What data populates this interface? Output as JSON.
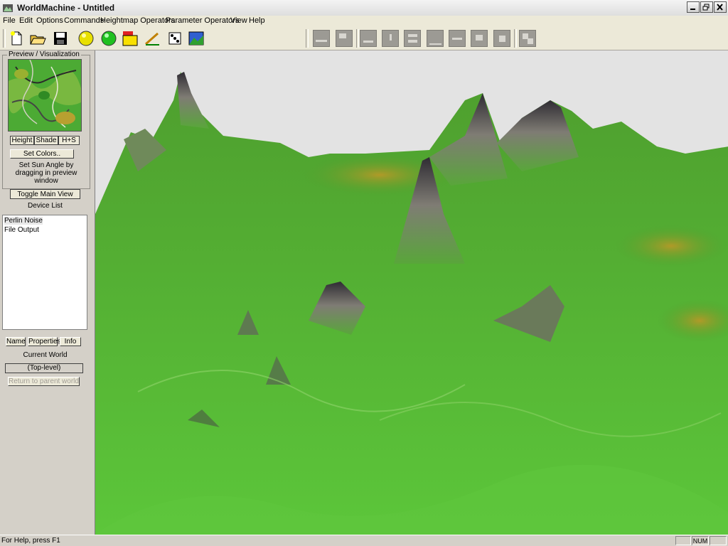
{
  "window": {
    "title": "WorldMachine - Untitled"
  },
  "menu": {
    "items": [
      "File",
      "Edit",
      "Options",
      "Commands",
      "Heightmap Operators",
      "Parameter Operators",
      "View",
      "Help"
    ]
  },
  "toolbar": {
    "buttons": [
      "new-file-icon",
      "open-folder-icon",
      "save-disk-icon",
      "yellow-sphere-icon",
      "green-sphere-icon",
      "red-yellow-block-icon",
      "pencil-ruler-icon",
      "render-dice-icon",
      "terrain-picture-icon"
    ],
    "disabled_buttons": [
      "wave-icon",
      "device-icon",
      "mountain-icon",
      "question-icon",
      "layout-icon",
      "flat-icon",
      "brush-icon",
      "cloud-icon",
      "gear-icon",
      "link-icon"
    ]
  },
  "left_panel": {
    "preview_label": "Preview / Visualization",
    "view_modes": [
      "Height",
      "Shade",
      "H+S"
    ],
    "set_colors": "Set Colors..",
    "sun_hint_line1": "Set Sun Angle by",
    "sun_hint_line2": "dragging in preview",
    "sun_hint_line3": "window",
    "toggle_main_view": "Toggle Main View",
    "device_list_label": "Device List",
    "devices": [
      "Perlin Noise",
      "File Output"
    ],
    "device_buttons": [
      "Name",
      "Properties",
      "Info"
    ],
    "current_world_label": "Current World",
    "current_world_value": "(Top-level)",
    "return_button": "Return to parent world"
  },
  "status": {
    "help_text": "For Help, press F1",
    "num_indicator": "NUM"
  },
  "colors": {
    "terrain_green": "#4aa52a",
    "terrain_peak": "#3a3640",
    "sky": "#e3e3e3",
    "chrome": "#d4d0c8"
  }
}
